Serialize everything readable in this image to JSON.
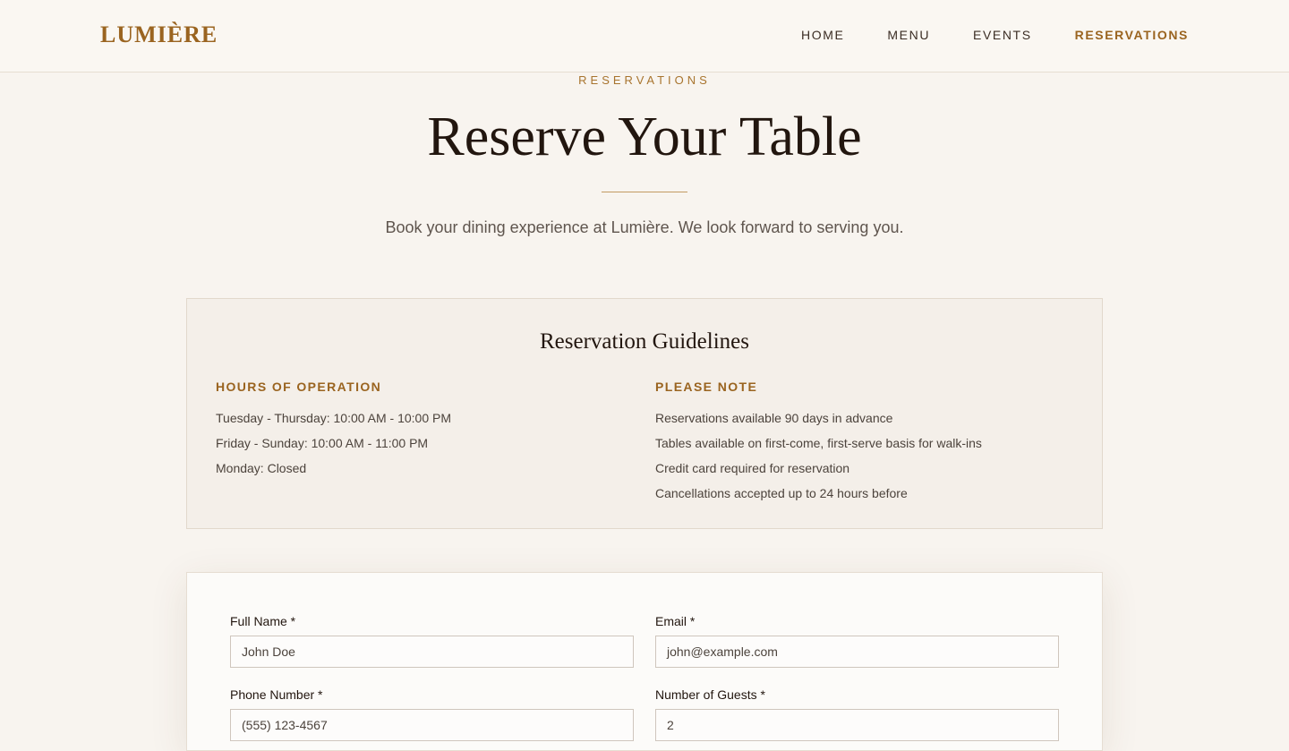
{
  "header": {
    "logo": "LUMIÈRE",
    "nav": [
      {
        "label": "HOME",
        "active": false
      },
      {
        "label": "MENU",
        "active": false
      },
      {
        "label": "EVENTS",
        "active": false
      },
      {
        "label": "RESERVATIONS",
        "active": true
      }
    ]
  },
  "hero": {
    "eyebrow": "RESERVATIONS",
    "title": "Reserve Your Table",
    "subtitle": "Book your dining experience at Lumière. We look forward to serving you."
  },
  "guidelines": {
    "title": "Reservation Guidelines",
    "hours": {
      "heading": "HOURS OF OPERATION",
      "items": [
        "Tuesday - Thursday: 10:00 AM - 10:00 PM",
        "Friday - Sunday: 10:00 AM - 11:00 PM",
        "Monday: Closed"
      ]
    },
    "note": {
      "heading": "PLEASE NOTE",
      "items": [
        "Reservations available 90 days in advance",
        "Tables available on first-come, first-serve basis for walk-ins",
        "Credit card required for reservation",
        "Cancellations accepted up to 24 hours before"
      ]
    }
  },
  "form": {
    "full_name": {
      "label": "Full Name *",
      "placeholder": "John Doe"
    },
    "email": {
      "label": "Email *",
      "placeholder": "john@example.com"
    },
    "phone": {
      "label": "Phone Number *",
      "placeholder": "(555) 123-4567"
    },
    "guests": {
      "label": "Number of Guests *",
      "value": "2"
    }
  },
  "colors": {
    "accent": "#9a6420",
    "background": "#f8f4ef",
    "text": "#22160f"
  }
}
